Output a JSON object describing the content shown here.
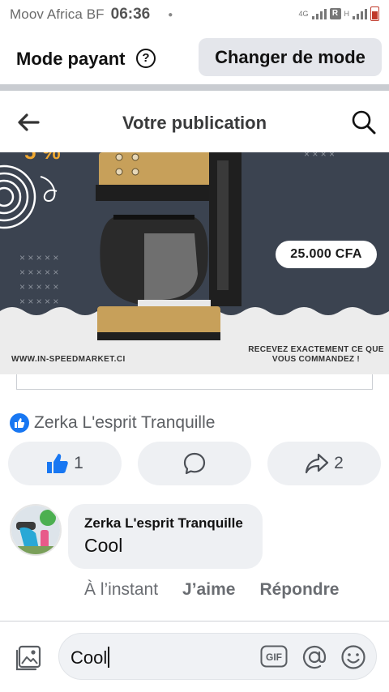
{
  "status_bar": {
    "carrier": "Moov Africa BF",
    "time": "06:36",
    "network_4g": "4G",
    "network_h": "H",
    "r_label": "R"
  },
  "mode_bar": {
    "label": "Mode payant",
    "help_symbol": "?",
    "button_label": "Changer de mode"
  },
  "header": {
    "title": "Votre publication",
    "back_icon": "arrow-left-icon",
    "search_icon": "search-icon"
  },
  "post_image": {
    "price": "25.000 CFA",
    "url": "WWW.IN-SPEEDMARKET.CI",
    "tagline": "RECEVEZ EXACTEMENT CE QUE VOUS COMMANDEZ !"
  },
  "reactions": {
    "name": "Zerka L'esprit Tranquille"
  },
  "actions": {
    "like_count": "1",
    "share_count": "2"
  },
  "comment": {
    "author": "Zerka L'esprit Tranquille",
    "text": "Cool",
    "time": "À l’instant",
    "like_label": "J’aime",
    "reply_label": "Répondre"
  },
  "composer": {
    "value": "Cool",
    "gif_label": "GIF"
  },
  "colors": {
    "facebook_blue": "#1877f2",
    "button_gray": "#e4e6eb",
    "bubble_gray": "#eef0f3"
  }
}
